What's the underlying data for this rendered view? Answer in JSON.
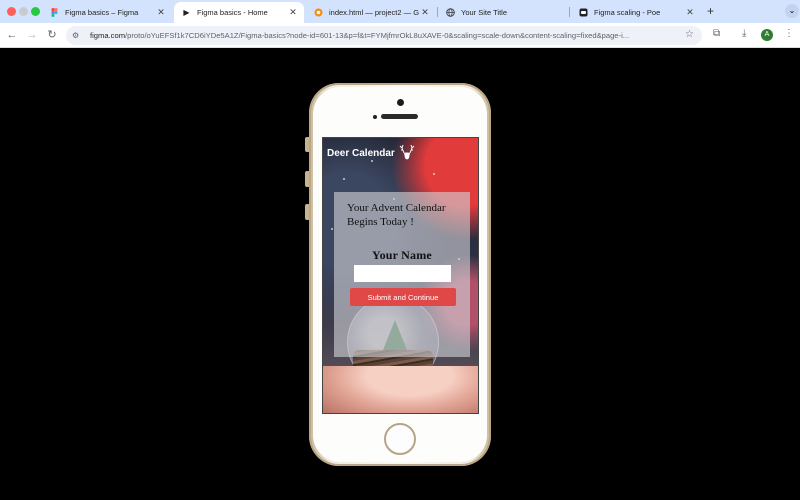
{
  "browser": {
    "tabs": [
      {
        "title": "Figma basics – Figma",
        "icon": "figma-icon",
        "active": false
      },
      {
        "title": "Figma basics - Home",
        "icon": "play-icon",
        "active": true
      },
      {
        "title": "index.html — project2 — Gitp",
        "icon": "gitpod-icon",
        "active": false
      },
      {
        "title": "Your Site Title",
        "icon": "globe-icon",
        "active": false
      },
      {
        "title": "Figma scaling - Poe",
        "icon": "poe-icon",
        "active": false
      }
    ],
    "new_tab": "+",
    "tab_menu": "⌄",
    "url_domain": "figma.com",
    "url_path": "/proto/oYuEFSf1k7CD6iYDe5A1Z/Figma-basics?node-id=601-13&p=f&t=FYMjfmrOkL8uXAVE-0&scaling=scale-down&content-scaling=fixed&page-i...",
    "profile_initial": "A"
  },
  "app": {
    "brand": "Deer Calendar",
    "headline": "Your Advent Calendar Begins Today !",
    "name_label": "Your Name",
    "name_value": "",
    "submit_label": "Submit and Continue"
  },
  "colors": {
    "accent": "#e04848",
    "tabstrip": "#d3e3fd",
    "phone_frame": "#f3ece1"
  }
}
